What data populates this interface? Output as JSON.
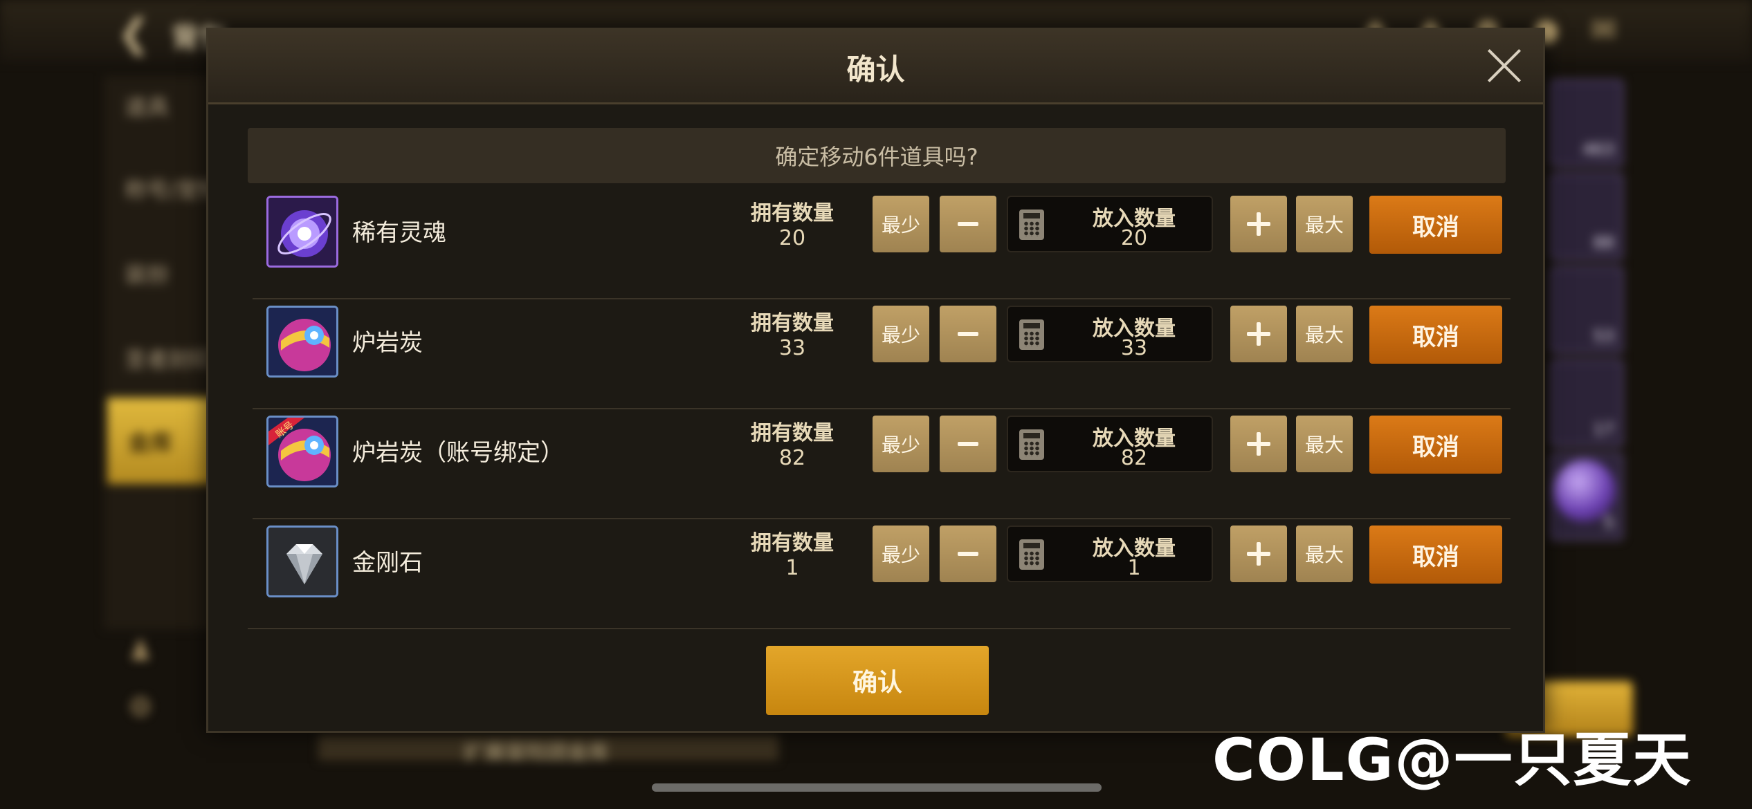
{
  "background": {
    "title": "背包",
    "tabs": [
      "道具",
      "称号/宠物",
      "装扮",
      "圣者封印",
      "金库"
    ],
    "active_tab": "金库",
    "bottom_text": "扩展冒险团金库",
    "slot_counts": [
      "463",
      "88",
      "53",
      "17",
      "5"
    ]
  },
  "dialog": {
    "title": "确认",
    "prompt": "确定移动6件道具吗?",
    "owned_label": "拥有数量",
    "put_label": "放入数量",
    "min_label": "最少",
    "max_label": "最大",
    "cancel_label": "取消",
    "confirm_label": "确认",
    "items": [
      {
        "name": "稀有灵魂",
        "owned": "20",
        "put": "20",
        "icon": "rare-soul-icon"
      },
      {
        "name": "炉岩炭",
        "owned": "33",
        "put": "33",
        "icon": "furnace-coal-icon"
      },
      {
        "name": "炉岩炭（账号绑定）",
        "owned": "82",
        "put": "82",
        "icon": "furnace-coal-bound-icon",
        "badge": "账号"
      },
      {
        "name": "金刚石",
        "owned": "1",
        "put": "1",
        "icon": "diamond-icon"
      }
    ]
  },
  "watermark": "COLG@一只夏天",
  "colors": {
    "cancel": "#c96a10",
    "confirm": "#d5961c",
    "tan_button": "#b0925c",
    "accent_border": "#6a8fc7"
  }
}
